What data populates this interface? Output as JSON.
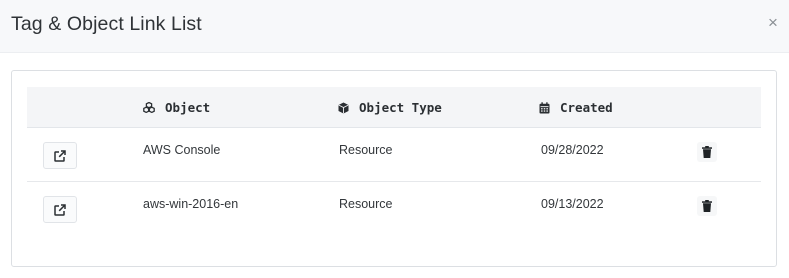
{
  "modal": {
    "title": "Tag & Object Link List",
    "close_glyph": "×"
  },
  "table": {
    "columns": [
      {
        "key": "object",
        "label": "Object",
        "icon": "cubes-icon"
      },
      {
        "key": "object_type",
        "label": "Object Type",
        "icon": "cube-icon"
      },
      {
        "key": "created",
        "label": "Created",
        "icon": "calendar-icon"
      }
    ],
    "rows": [
      {
        "object": "AWS Console",
        "object_type": "Resource",
        "created": "09/28/2022"
      },
      {
        "object": "aws-win-2016-en",
        "object_type": "Resource",
        "created": "09/13/2022"
      }
    ]
  },
  "icons": {
    "row_open": "external-link-icon",
    "row_delete": "trash-icon",
    "close": "close-icon"
  },
  "colors": {
    "header_bg": "#f7f8fa",
    "table_head_bg": "#f4f5f7",
    "icon": "#2b2f33"
  }
}
